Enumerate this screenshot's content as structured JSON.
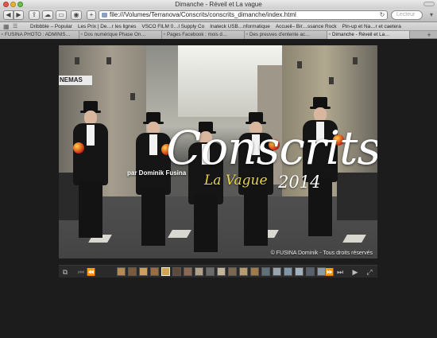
{
  "window": {
    "title": "Dimanche - Réveil et La vague"
  },
  "toolbar": {
    "url": "file:///Volumes/Terranova/Conscrits/conscrits_dimanche/index.html",
    "search_placeholder": "Lecteur"
  },
  "bookmarks": [
    "Dribbble – Popular",
    "Les Prix | De…r les lignes",
    "VSCO FILM 0…l Supply Co",
    "Inateck USB…nformatique",
    "Accueil– Bir…ssance Rock",
    "Pin-up et Na…r et caetera"
  ],
  "tabs": [
    {
      "label": "FUSINA PHOTO : ADMINIS…",
      "active": false
    },
    {
      "label": "Dos numérique Phase On…",
      "active": false
    },
    {
      "label": "Pages Facebook : mois d…",
      "active": false
    },
    {
      "label": "Des preuves d'entente ac…",
      "active": false
    },
    {
      "label": "Dimanche - Réveil et La…",
      "active": true
    }
  ],
  "photo": {
    "title": "Conscrits",
    "subtitle": "La Vague",
    "year": "2014",
    "byline": "par Dominik Fusina",
    "sign": "NEMAS",
    "copyright": "© FUSINA Dominik - Tous droits réservés"
  },
  "filmstrip": {
    "thumb_count": 19,
    "active_index": 4
  },
  "colors": {
    "page_bg": "#1c1c1c",
    "title_text": "#ffffff",
    "subtitle_text": "#e7d34b"
  }
}
